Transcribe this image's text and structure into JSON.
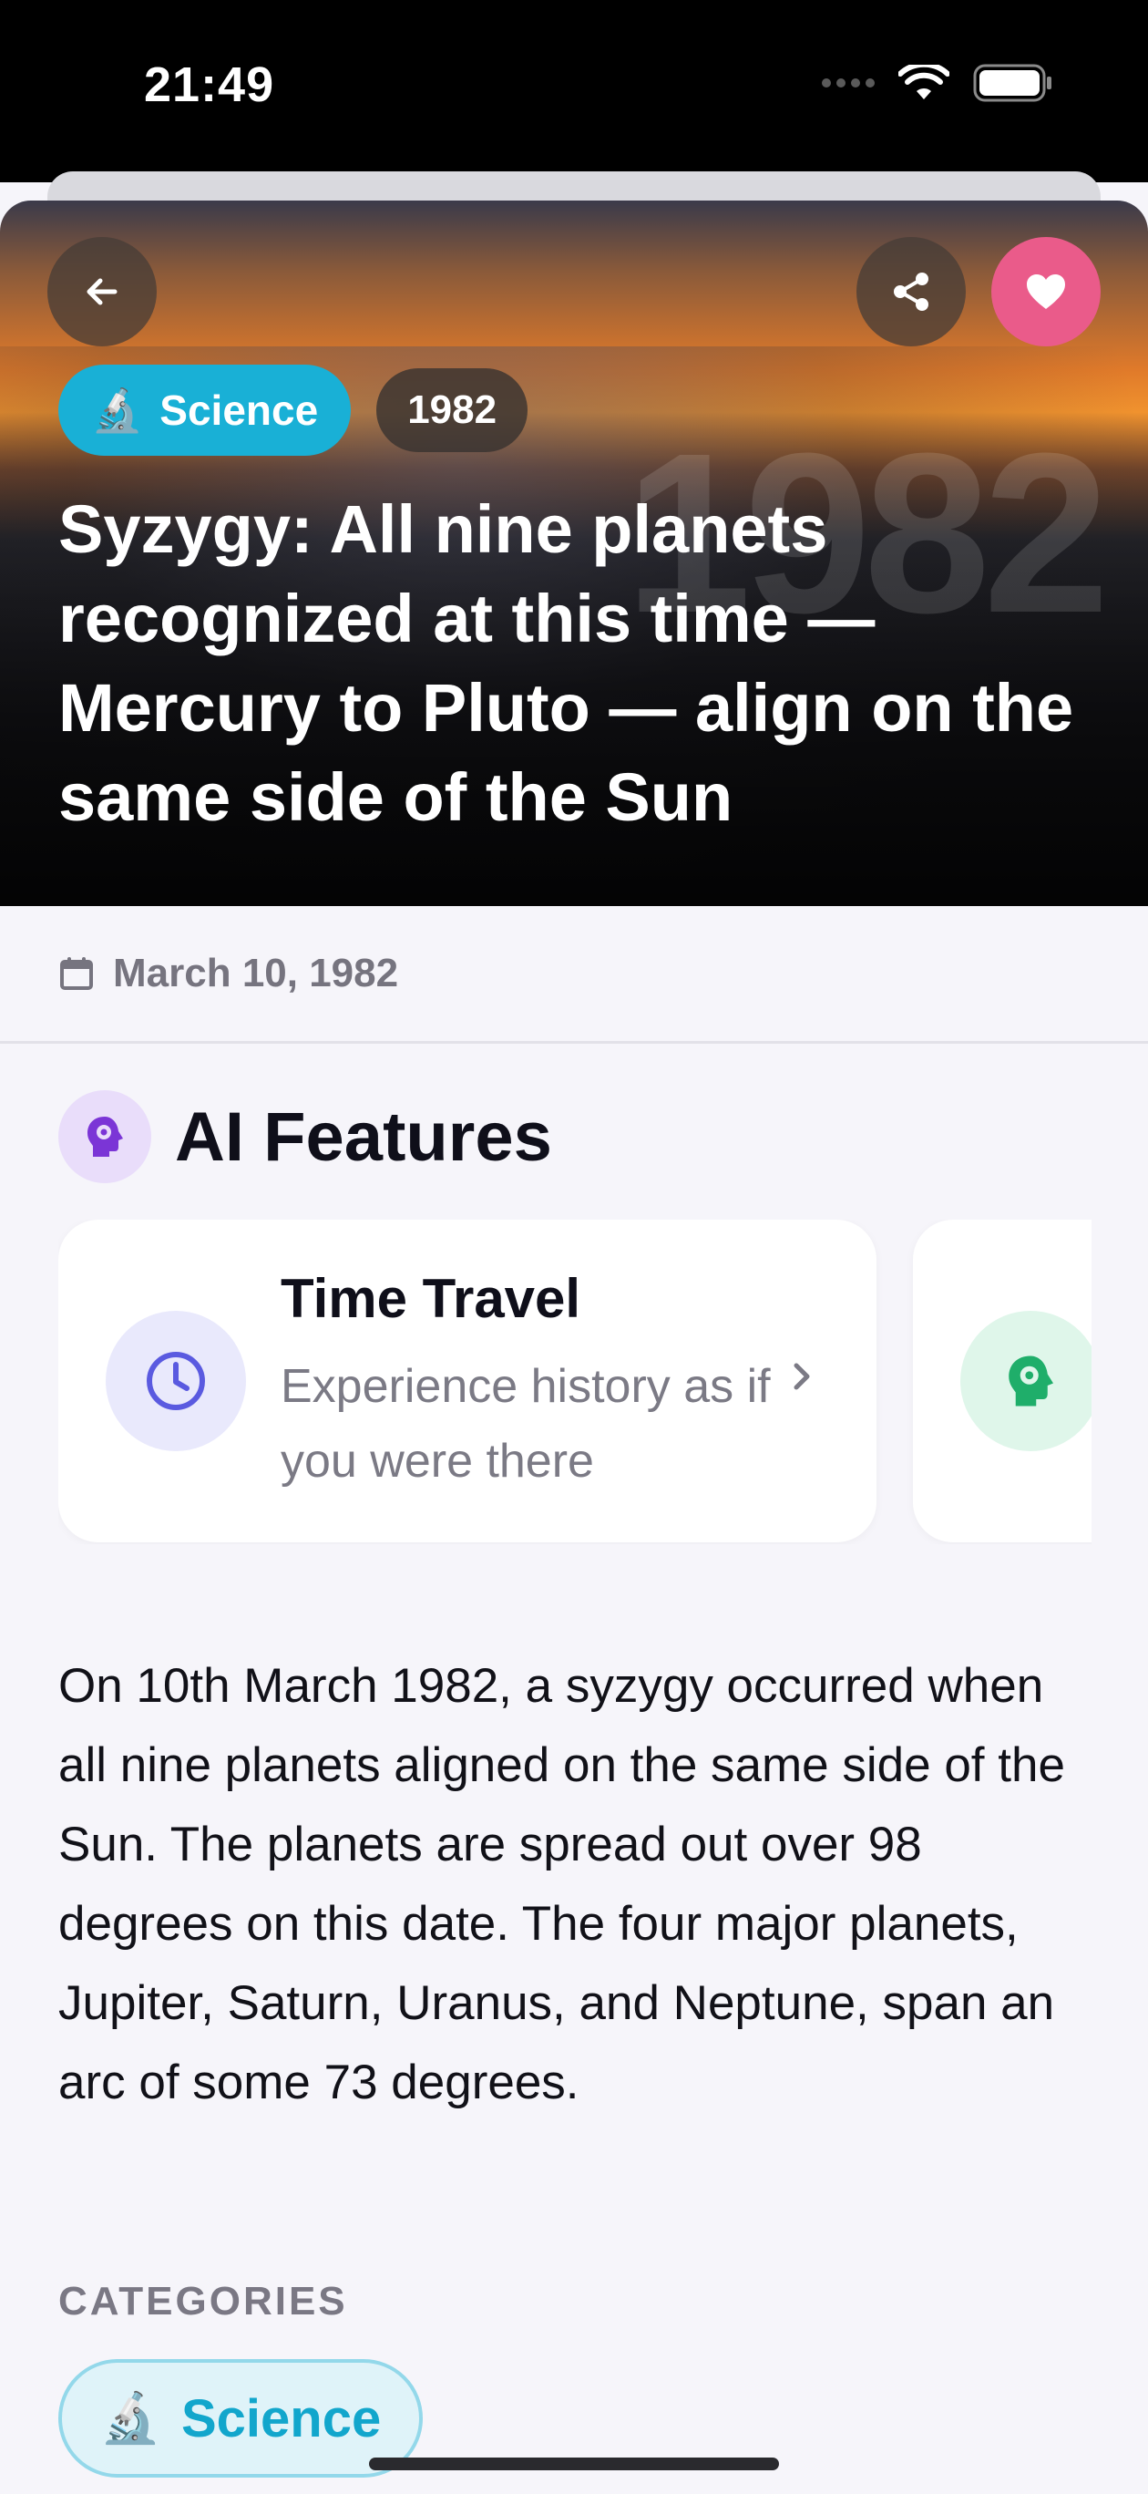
{
  "status_bar": {
    "time": "21:49"
  },
  "hero": {
    "category_emoji": "🔬",
    "category_label": "Science",
    "year": "1982",
    "watermark": "1982",
    "title": "Syzygy: All nine planets recognized at this time — Mercury to Pluto — align on the same side of the Sun"
  },
  "date": "March 10, 1982",
  "ai_features": {
    "heading": "AI Features",
    "cards": [
      {
        "title": "Time Travel",
        "description": "Experience history as if you were there",
        "icon": "clock-icon"
      },
      {
        "title": "",
        "description": "",
        "icon": "ai-head-icon"
      }
    ]
  },
  "article_body": "On 10th March 1982, a syzygy occurred when all nine planets aligned on the same side of the Sun. The planets are spread out over 98 degrees on this date. The four major planets, Jupiter, Saturn, Uranus, and Neptune, span an arc of some 73 degrees.",
  "categories": {
    "label": "CATEGORIES",
    "items": [
      {
        "emoji": "🔬",
        "label": "Science"
      }
    ]
  },
  "colors": {
    "accent_cyan": "#19b0d6",
    "favorite_pink": "#ea5b8a",
    "ai_purple": "#7b35d6",
    "clock_indigo": "#5a5ae0",
    "ai_green": "#1fae6a"
  }
}
